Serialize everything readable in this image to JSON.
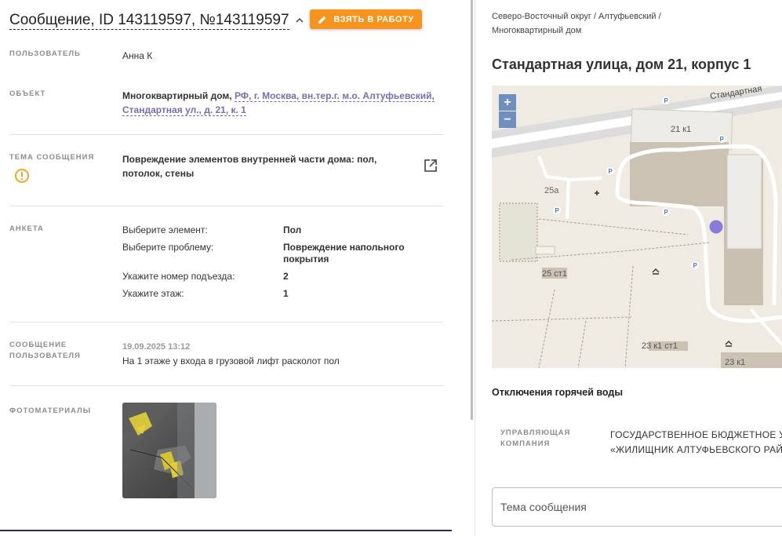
{
  "header": {
    "title": "Сообщение, ID 143119597, №143119597",
    "take_button": "ВЗЯТЬ В РАБОТУ"
  },
  "fields": {
    "user_label": "ПОЛЬЗОВАТЕЛЬ",
    "user_value": "Анна К",
    "object_label": "ОБЪЕКТ",
    "object_type": "Многоквартирный дом,",
    "object_address_line1": "РФ, г. Москва, вн.тер.г. м.о. Алтуфьевский,",
    "object_address_line2": "Стандартная ул., д. 21, к. 1",
    "topic_label": "ТЕМА СООБЩЕНИЯ",
    "topic_line1": "Повреждение элементов внутренней части дома: пол,",
    "topic_line2": "потолок, стены",
    "survey_label": "АНКЕТА",
    "message_label_1": "СООБЩЕНИЕ",
    "message_label_2": "ПОЛЬЗОВАТЕЛЯ",
    "message_date": "19.09.2025 13:12",
    "message_text": "На 1 этаже у входа в грузовой лифт расколот пол",
    "photos_label": "ФОТОМАТЕРИАЛЫ"
  },
  "survey": [
    {
      "q": "Выберите элемент:",
      "a1": "Пол",
      "a2": ""
    },
    {
      "q": "Выберите проблему:",
      "a1": "Повреждение напольного",
      "a2": "покрытия"
    },
    {
      "q": "Укажите номер подъезда:",
      "a1": "2",
      "a2": ""
    },
    {
      "q": "Укажите этаж:",
      "a1": "1",
      "a2": ""
    }
  ],
  "right": {
    "breadcrumb_line1": "Северо-Восточный округ / Алтуфьевский /",
    "breadcrumb_line2": "Многоквартирный дом",
    "address": "Стандартная улица, дом 21, корпус 1",
    "map": {
      "street": "Стандартная",
      "labels": [
        "21 к1",
        "25а",
        "25 ст1",
        "23 к1 ст1",
        "23 к1"
      ],
      "zoom_in": "+",
      "zoom_out": "−"
    },
    "hot_water": "Отключения горячей воды",
    "uk_label_1": "УПРАВЛЯЮЩАЯ",
    "uk_label_2": "КОМПАНИЯ",
    "uk_value_1": "ГОСУДАРСТВЕННОЕ БЮДЖЕТНОЕ УЧР",
    "uk_value_2": "«ЖИЛИЩНИК АЛТУФЬЕВСКОГО РАЙО",
    "topic_input_placeholder": "Тема сообщения"
  },
  "colors": {
    "accent_orange": "#f7941d",
    "link_purple": "#7b6db3",
    "warning_orange": "#f5a623",
    "map_marker": "#8b7bd8"
  },
  "icons": {
    "collapse": "chevron-up-icon",
    "edit": "pencil-icon",
    "warning": "warning-circle-icon",
    "external": "open-in-new-icon"
  }
}
